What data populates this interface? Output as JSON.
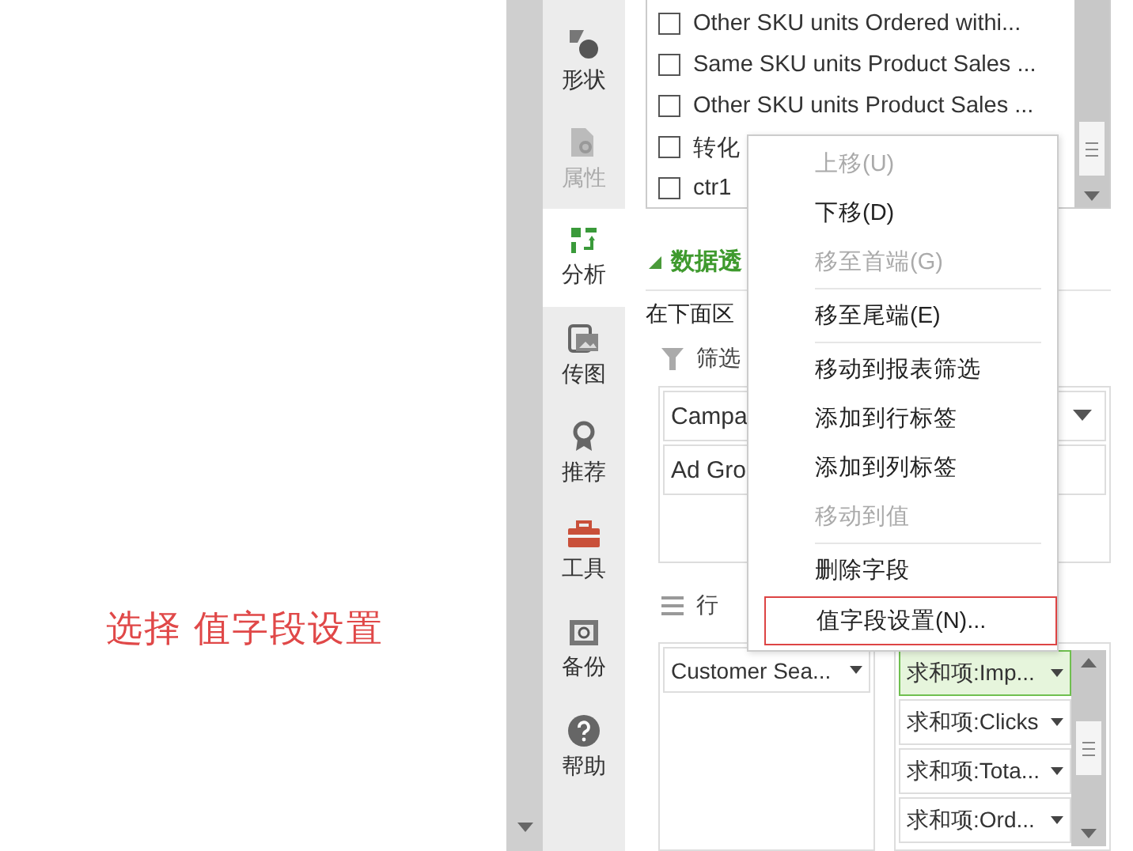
{
  "annotation": "选择 值字段设置",
  "sidebar": {
    "items": [
      {
        "label": "形状",
        "kind": "shape",
        "disabled": false,
        "selected": false
      },
      {
        "label": "属性",
        "kind": "property",
        "disabled": true,
        "selected": false
      },
      {
        "label": "分析",
        "kind": "analysis",
        "disabled": false,
        "selected": true
      },
      {
        "label": "传图",
        "kind": "image",
        "disabled": false,
        "selected": false
      },
      {
        "label": "推荐",
        "kind": "award",
        "disabled": false,
        "selected": false
      },
      {
        "label": "工具",
        "kind": "toolbox",
        "disabled": false,
        "selected": false
      },
      {
        "label": "备份",
        "kind": "backup",
        "disabled": false,
        "selected": false
      },
      {
        "label": "帮助",
        "kind": "help",
        "disabled": false,
        "selected": false
      }
    ]
  },
  "field_list": {
    "fields": [
      {
        "label": "Other SKU units Ordered withi...",
        "checked": false
      },
      {
        "label": "Same SKU units Product Sales ...",
        "checked": false
      },
      {
        "label": "Other SKU units Product Sales ...",
        "checked": false
      },
      {
        "label": "转化",
        "checked": false
      },
      {
        "label": "ctr1",
        "checked": false
      }
    ]
  },
  "section_title": "数据透",
  "hint": "在下面区",
  "filter": {
    "label": "筛选",
    "items": [
      "Campa",
      "Ad Gro"
    ]
  },
  "rows": {
    "label": "行",
    "items": [
      "Customer Sea..."
    ]
  },
  "values": {
    "items": [
      {
        "label": "求和项:Imp...",
        "selected": true
      },
      {
        "label": "求和项:Clicks",
        "selected": false
      },
      {
        "label": "求和项:Tota...",
        "selected": false
      },
      {
        "label": "求和项:Ord...",
        "selected": false
      }
    ]
  },
  "context_menu": {
    "items": [
      {
        "label": "上移(U)",
        "disabled": true,
        "highlighted": false,
        "separator_after": false
      },
      {
        "label": "下移(D)",
        "disabled": false,
        "highlighted": false,
        "separator_after": false
      },
      {
        "label": "移至首端(G)",
        "disabled": true,
        "highlighted": false,
        "separator_after": true
      },
      {
        "label": "移至尾端(E)",
        "disabled": false,
        "highlighted": false,
        "separator_after": true
      },
      {
        "label": "移动到报表筛选",
        "disabled": false,
        "highlighted": false,
        "separator_after": false
      },
      {
        "label": "添加到行标签",
        "disabled": false,
        "highlighted": false,
        "separator_after": false
      },
      {
        "label": "添加到列标签",
        "disabled": false,
        "highlighted": false,
        "separator_after": false
      },
      {
        "label": "移动到值",
        "disabled": true,
        "highlighted": false,
        "separator_after": true
      },
      {
        "label": "删除字段",
        "disabled": false,
        "highlighted": false,
        "separator_after": false
      },
      {
        "label": "值字段设置(N)...",
        "disabled": false,
        "highlighted": true,
        "separator_after": false
      }
    ]
  }
}
